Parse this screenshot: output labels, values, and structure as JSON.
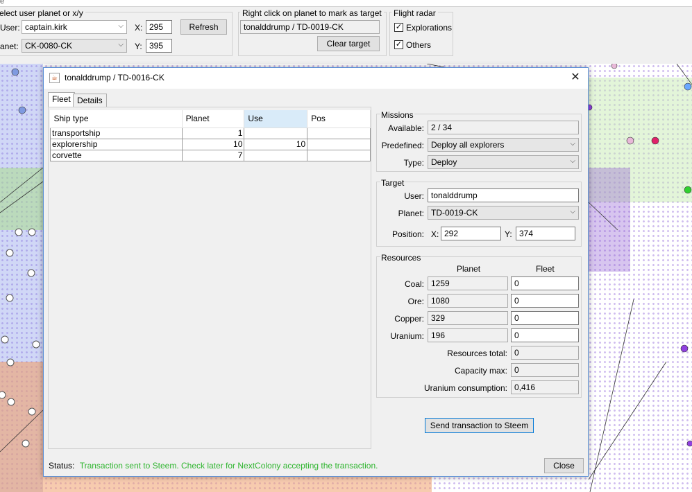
{
  "menu": {
    "fragment": "e"
  },
  "select_group": {
    "title": "elect user planet or x/y",
    "user_label": "User:",
    "user_value": "captain.kirk",
    "planet_label": "anet:",
    "planet_value": "CK-0080-CK",
    "x_label": "X:",
    "x_value": "295",
    "y_label": "Y:",
    "y_value": "395",
    "refresh_label": "Refresh"
  },
  "target_group": {
    "title": "Right click on planet to mark as target",
    "target_value": "tonalddrump / TD-0019-CK",
    "clear_label": "Clear target"
  },
  "radar_group": {
    "title": "Flight radar",
    "explorations_label": "Explorations",
    "others_label": "Others",
    "explorations_checked": true,
    "others_checked": true
  },
  "dialog": {
    "title": "tonalddrump / TD-0016-CK",
    "tabs": [
      {
        "label": "Fleet",
        "active": true
      },
      {
        "label": "Details",
        "active": false
      }
    ],
    "fleet_table": {
      "columns": [
        "Ship type",
        "Planet",
        "Use",
        "Pos"
      ],
      "rows": [
        {
          "ship": "transportship",
          "planet": "1",
          "use": "",
          "pos": ""
        },
        {
          "ship": "explorership",
          "planet": "10",
          "use": "10",
          "pos": ""
        },
        {
          "ship": "corvette",
          "planet": "7",
          "use": "",
          "pos": ""
        }
      ]
    },
    "missions": {
      "title": "Missions",
      "available_label": "Available:",
      "available_value": "2 / 34",
      "predefined_label": "Predefined:",
      "predefined_value": "Deploy all explorers",
      "type_label": "Type:",
      "type_value": "Deploy"
    },
    "target": {
      "title": "Target",
      "user_label": "User:",
      "user_value": "tonalddrump",
      "planet_label": "Planet:",
      "planet_value": "TD-0019-CK",
      "position_label": "Position:",
      "x_label": "X:",
      "x_value": "292",
      "y_label": "Y:",
      "y_value": "374"
    },
    "resources": {
      "title": "Resources",
      "col_planet": "Planet",
      "col_fleet": "Fleet",
      "rows": [
        {
          "label": "Coal:",
          "planet": "1259",
          "fleet": "0"
        },
        {
          "label": "Ore:",
          "planet": "1080",
          "fleet": "0"
        },
        {
          "label": "Copper:",
          "planet": "329",
          "fleet": "0"
        },
        {
          "label": "Uranium:",
          "planet": "196",
          "fleet": "0"
        }
      ],
      "total_label": "Resources total:",
      "total_value": "0",
      "capacity_label": "Capacity max:",
      "capacity_value": "0",
      "consumption_label": "Uranium consumption:",
      "consumption_value": "0,416"
    },
    "send_label": "Send transaction to Steem",
    "status_label": "Status:",
    "status_message": "Transaction sent to Steem. Check later for NextColony accepting the transaction.",
    "close_label": "Close"
  },
  "colors": {
    "status_ok": "#2fb52f",
    "map_dot": "#9a6ee0",
    "zone_green": "#b8e0a0",
    "zone_orange": "#f0a878",
    "zone_blue": "#8aa0e8",
    "selected_header": "#d9ebf9"
  }
}
